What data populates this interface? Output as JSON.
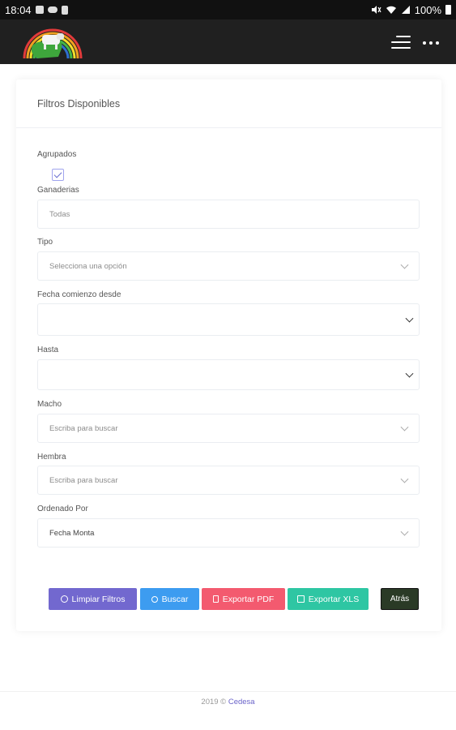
{
  "status_bar": {
    "time": "18:04",
    "battery": "100%",
    "left_icons": [
      "image-icon",
      "cloud-icon",
      "clipboard-icon"
    ],
    "right_icons": [
      "mute-icon",
      "wifi-icon",
      "signal-icon"
    ]
  },
  "app_bar": {
    "icons": [
      "app-logo",
      "hamburger-icon",
      "more-options-icon"
    ]
  },
  "card": {
    "title": "Filtros Disponibles",
    "fields": {
      "agrupados": {
        "label": "Agrupados",
        "checked": true
      },
      "ganaderias": {
        "label": "Ganaderias",
        "placeholder": "Todas"
      },
      "tipo": {
        "label": "Tipo",
        "placeholder": "Selecciona una opción"
      },
      "fecha_desde": {
        "label": "Fecha comienzo desde",
        "value": ""
      },
      "hasta": {
        "label": "Hasta",
        "value": ""
      },
      "macho": {
        "label": "Macho",
        "placeholder": "Escriba para buscar"
      },
      "hembra": {
        "label": "Hembra",
        "placeholder": "Escriba para buscar"
      },
      "ordenado_por": {
        "label": "Ordenado Por",
        "value": "Fecha Monta"
      }
    },
    "buttons": {
      "clear": "Limpiar Filtros",
      "search": "Buscar",
      "export_pdf": "Exportar PDF",
      "export_xls": "Exportar XLS",
      "back": "Atrás"
    }
  },
  "footer": {
    "copyright": "2019 ©",
    "brand": "Cedesa"
  },
  "colors": {
    "clear_button": "#7268cf",
    "search_button": "#3d9cf0",
    "pdf_button": "#f35a6f",
    "xls_button": "#2ec6a3",
    "back_button": "#2a3a26",
    "brand_link": "#6a63c9"
  }
}
